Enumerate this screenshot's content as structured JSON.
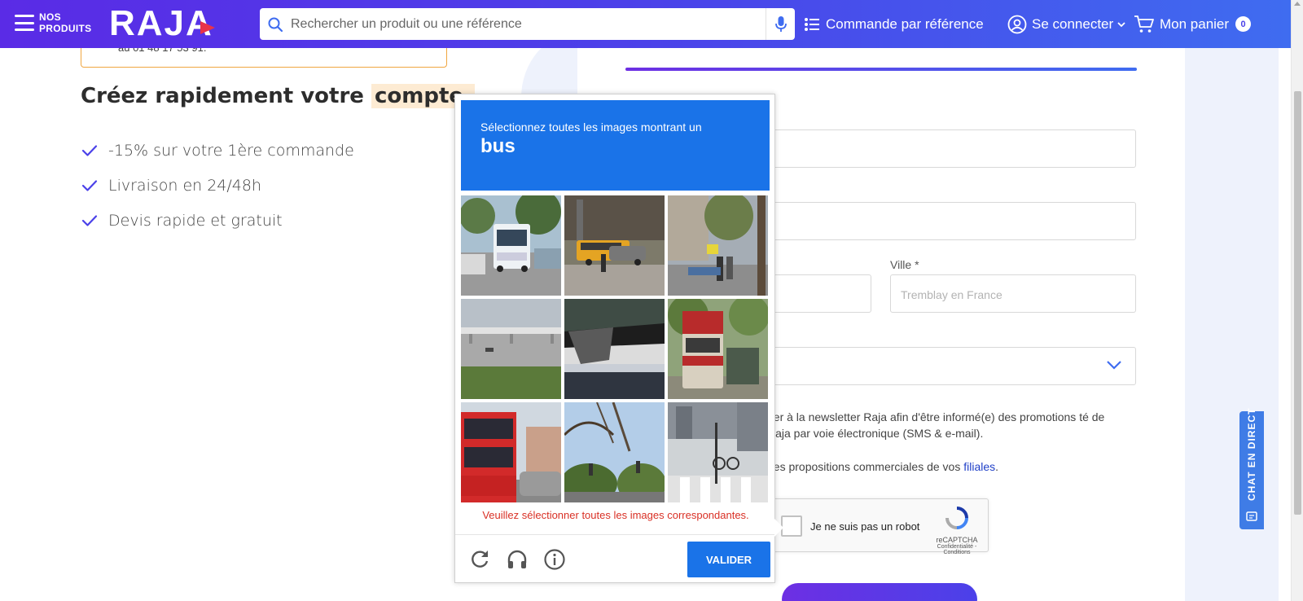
{
  "header": {
    "menu_label": "NOS PRODUITS",
    "logo": "RAJA",
    "search_placeholder": "Rechercher un produit ou une référence",
    "order_by_ref": "Commande par référence",
    "login": "Se connecter",
    "cart_label": "Mon panier",
    "cart_count": "0"
  },
  "left": {
    "info_text": "au 01 48 17 53 91.",
    "title": "Créez rapidement votre",
    "title_highlight": "compte.",
    "benefits": [
      "-15% sur votre 1ère commande",
      "Livraison en 24/48h",
      "Devis rapide et gratuit"
    ]
  },
  "form": {
    "city_label": "Ville *",
    "city_placeholder": "Tremblay en France",
    "newsletter_text": "ner à la newsletter Raja afin d'être informé(e) des promotions té de Raja par voie électronique (SMS & e-mail).",
    "propositions_text": "des propositions commerciales de vos",
    "propositions_link": "filiales",
    "propositions_end": ".",
    "recaptcha_label": "Je ne suis pas un robot",
    "recaptcha_brand": "reCAPTCHA",
    "recaptcha_links": "Confidentialité - Conditions"
  },
  "chat": {
    "label": "CHAT EN DIRECT"
  },
  "captcha": {
    "prompt": "Sélectionnez toutes les images montrant un",
    "target": "bus",
    "error": "Veuillez sélectionner toutes les images correspondantes.",
    "verify_label": "VALIDER",
    "footer_icons": [
      "reload-icon",
      "audio-headphones-icon",
      "info-icon"
    ],
    "tiles": [
      {
        "subject": "white bus on road"
      },
      {
        "subject": "yellow school bus at intersection"
      },
      {
        "subject": "street with pedestrians and trees"
      },
      {
        "subject": "highway bridge"
      },
      {
        "subject": "truck trailer close-up"
      },
      {
        "subject": "red double-decker bus rear"
      },
      {
        "subject": "red double-decker bus front"
      },
      {
        "subject": "trees and traffic lights"
      },
      {
        "subject": "crosswalk with bicycle"
      }
    ]
  },
  "colors": {
    "header_gradient_start": "#5a2be6",
    "header_gradient_end": "#3f6cf0",
    "captcha_blue": "#1a73e8",
    "error_red": "#d93025",
    "check_purple": "#4b41e9"
  }
}
